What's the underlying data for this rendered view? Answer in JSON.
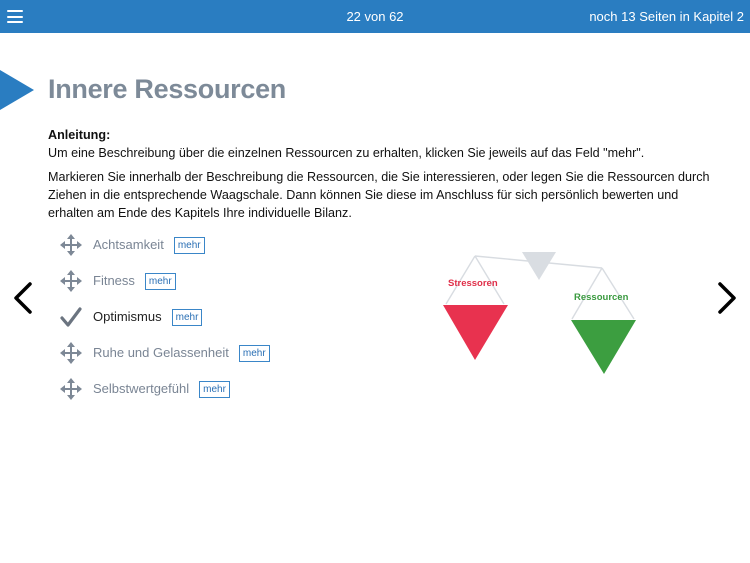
{
  "header": {
    "page_count": "22 von 62",
    "chapter_info": "noch 13 Seiten in Kapitel 2"
  },
  "page": {
    "title": "Innere Ressourcen",
    "instructions_heading": "Anleitung",
    "instructions_line1": "Um eine Beschreibung über die einzelnen Ressourcen zu erhalten, klicken Sie jeweils auf das Feld \"mehr\".",
    "instructions_para2": "Markieren Sie innerhalb der Beschreibung die Ressourcen, die Sie interessieren, oder legen Sie die Ressourcen durch Ziehen in die entsprechende Waagschale. Dann können Sie diese im Anschluss für sich persönlich bewerten und erhalten am Ende des Kapitels Ihre individuelle Bilanz."
  },
  "resources": [
    {
      "label": "Achtsamkeit",
      "more": "mehr",
      "icon": "move-icon"
    },
    {
      "label": "Fitness",
      "more": "mehr",
      "icon": "move-icon"
    },
    {
      "label": "Optimismus",
      "more": "mehr",
      "icon": "checkmark-icon"
    },
    {
      "label": "Ruhe und Gelassenheit",
      "more": "mehr",
      "icon": "move-icon"
    },
    {
      "label": "Selbstwertgefühl",
      "more": "mehr",
      "icon": "move-icon"
    }
  ],
  "scale": {
    "left_label": "Stressoren",
    "right_label": "Ressourcen",
    "left_color": "#e8324f",
    "right_color": "#3c9e40",
    "pivot_color": "#d9dde2"
  },
  "colors": {
    "accent": "#2a7dc1",
    "title": "#7d8a98"
  }
}
